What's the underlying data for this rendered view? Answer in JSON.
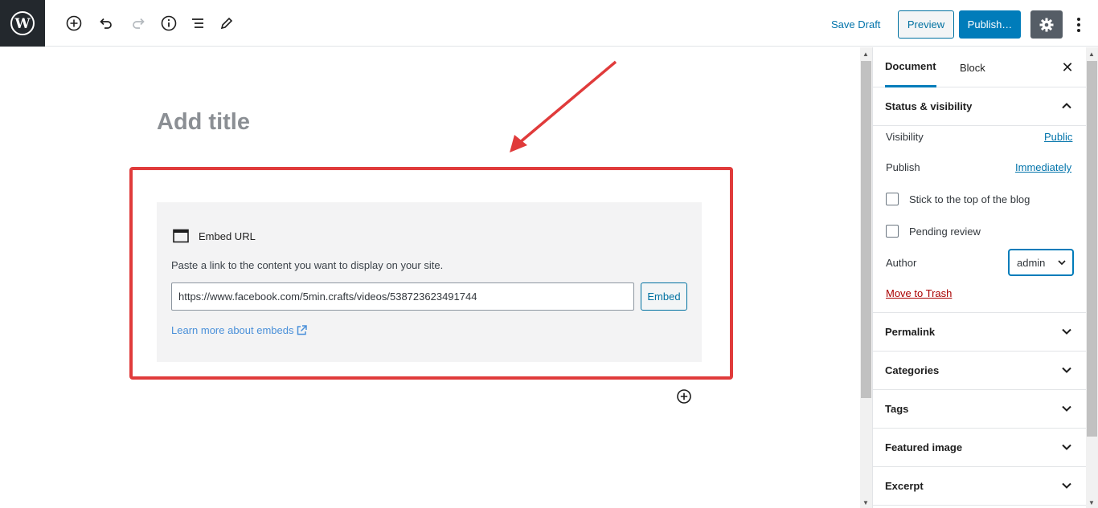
{
  "toolbar": {
    "save_draft": "Save Draft",
    "preview": "Preview",
    "publish": "Publish…",
    "icons": [
      "wordpress-logo",
      "add-block",
      "undo",
      "redo",
      "info",
      "outline",
      "edit-tool",
      "settings",
      "more-options"
    ]
  },
  "editor": {
    "title_placeholder": "Add title",
    "embed": {
      "title": "Embed URL",
      "description": "Paste a link to the content you want to display on your site.",
      "url_value": "https://www.facebook.com/5min.crafts/videos/538723623491744",
      "button": "Embed",
      "learn_more": "Learn more about embeds"
    }
  },
  "sidebar": {
    "tabs": [
      {
        "label": "Document",
        "active": true
      },
      {
        "label": "Block",
        "active": false
      }
    ],
    "status_visibility": {
      "title": "Status & visibility",
      "visibility_label": "Visibility",
      "visibility_value": "Public",
      "publish_label": "Publish",
      "publish_value": "Immediately",
      "sticky_label": "Stick to the top of the blog",
      "pending_label": "Pending review",
      "author_label": "Author",
      "author_value": "admin",
      "trash": "Move to Trash"
    },
    "panels": [
      "Permalink",
      "Categories",
      "Tags",
      "Featured image",
      "Excerpt"
    ]
  },
  "colors": {
    "accent": "#007cba",
    "highlight": "#e03b3b",
    "danger": "#a00"
  }
}
